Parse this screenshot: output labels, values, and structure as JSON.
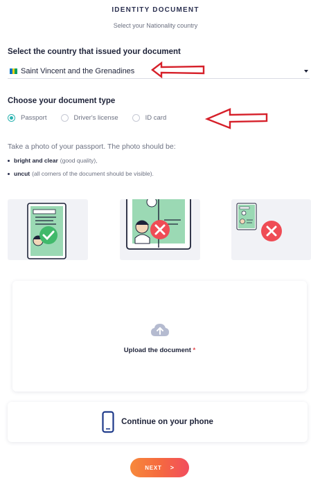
{
  "header": {
    "title": "IDENTITY DOCUMENT",
    "subtitle": "Select your Nationality country"
  },
  "country": {
    "label": "Select the country that issued your document",
    "selected": "Saint Vincent and the Grenadines",
    "flag_colors": [
      "#0072c6",
      "#fcd116",
      "#009e60"
    ]
  },
  "doc_type": {
    "label": "Choose your document type",
    "options": [
      {
        "label": "Passport",
        "checked": true
      },
      {
        "label": "Driver's license",
        "checked": false
      },
      {
        "label": "ID card",
        "checked": false
      }
    ]
  },
  "instructions": {
    "intro": "Take a photo of your passport. The photo should be:",
    "bullets": [
      {
        "bold": "bright and clear",
        "rest": "(good quality),"
      },
      {
        "bold": "uncut",
        "rest": "(all corners of the document should be visible)."
      }
    ]
  },
  "examples": [
    {
      "icon": "passport-correct-icon",
      "status": "correct"
    },
    {
      "icon": "passport-cropped-icon",
      "status": "incorrect"
    },
    {
      "icon": "passport-small-icon",
      "status": "incorrect"
    }
  ],
  "upload": {
    "label": "Upload the document",
    "required_mark": "*",
    "icon": "cloud-upload-icon"
  },
  "phone": {
    "label": "Continue on your phone",
    "icon": "smartphone-icon"
  },
  "next_button": {
    "label": "NEXT",
    "arrow": ">"
  },
  "colors": {
    "accent": "#2ab3b0",
    "error": "#e5484d",
    "button_start": "#f7893b",
    "button_end": "#f24d5e",
    "annotation": "#d6202a"
  }
}
